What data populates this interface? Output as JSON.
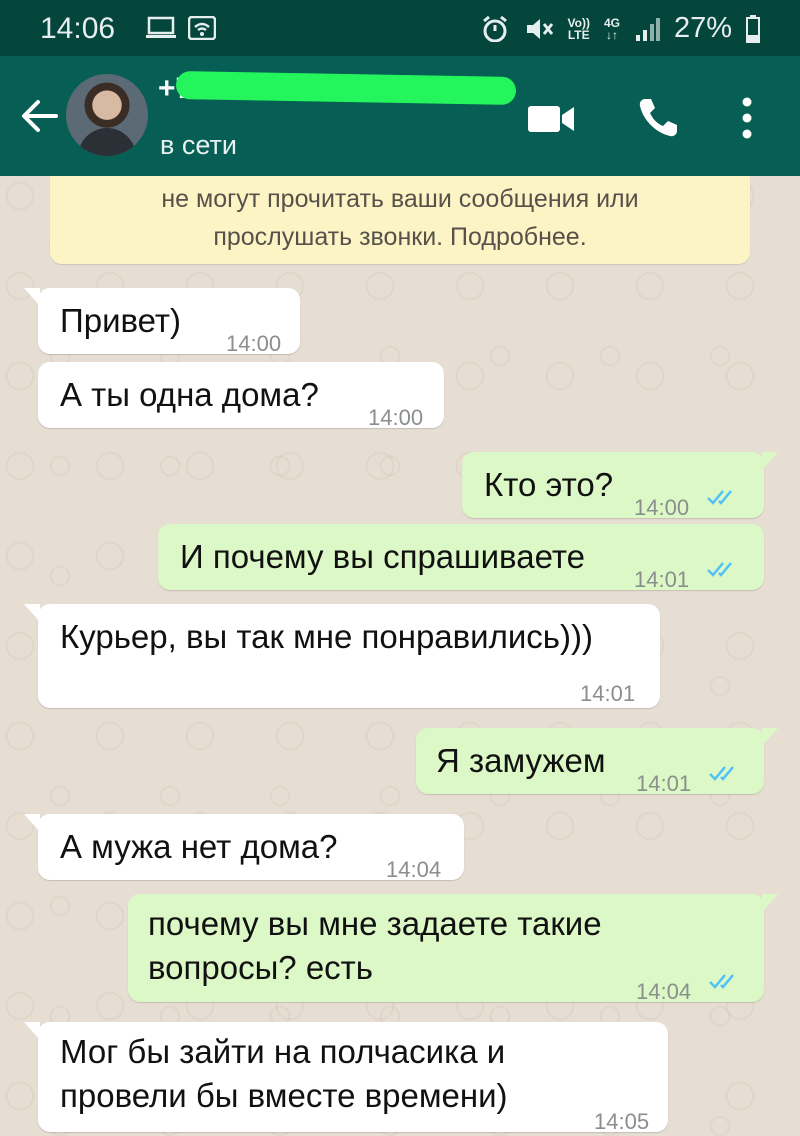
{
  "status_bar": {
    "time": "14:06",
    "volte": "Vo))",
    "lte": "LTE",
    "net_type": "4G",
    "battery": "27%"
  },
  "header": {
    "contact_name_visible": "+7",
    "status": "в сети",
    "accent": "#075e54"
  },
  "encryption_banner": {
    "line1": "не могут прочитать ваши сообщения или",
    "line2": "прослушать звонки. Подробнее."
  },
  "messages": [
    {
      "dir": "in",
      "text": "Привет)",
      "time": "14:00"
    },
    {
      "dir": "in",
      "text": "А ты одна дома?",
      "time": "14:00"
    },
    {
      "dir": "out",
      "text": "Кто это?",
      "time": "14:00",
      "status": "read"
    },
    {
      "dir": "out",
      "text": "И почему вы спрашиваете",
      "time": "14:01",
      "status": "read"
    },
    {
      "dir": "in",
      "text": "Курьер, вы так мне понравились)))",
      "time": "14:01"
    },
    {
      "dir": "out",
      "text": "Я замужем",
      "time": "14:01",
      "status": "read"
    },
    {
      "dir": "in",
      "text": "А мужа нет дома?",
      "time": "14:04"
    },
    {
      "dir": "out",
      "lines": [
        "почему вы мне задаете такие",
        "вопросы? есть"
      ],
      "time": "14:04",
      "status": "read"
    },
    {
      "dir": "in",
      "lines": [
        "Мог бы зайти на полчасика и",
        "провели бы вместе времени)"
      ],
      "time": "14:05"
    }
  ],
  "colors": {
    "outgoing_bubble": "#dcf8c6",
    "incoming_bubble": "#ffffff",
    "read_tick": "#4fc3f7",
    "banner": "#fdf4c5"
  }
}
